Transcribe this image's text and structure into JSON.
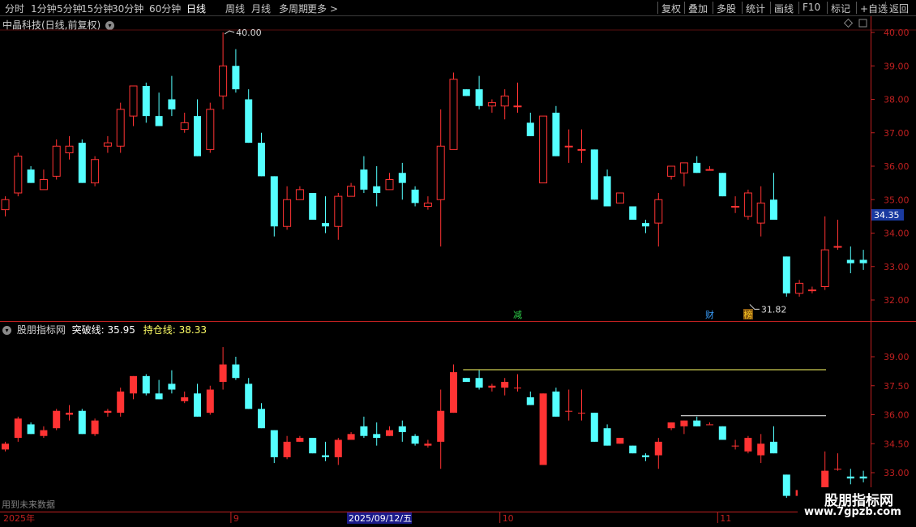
{
  "toolbar": {
    "periods": [
      "分时",
      "1分钟",
      "5分钟",
      "15分钟",
      "30分钟",
      "60分钟",
      "日线",
      "周线",
      "月线",
      "多周期",
      "更多 >"
    ],
    "active_period": "日线",
    "right_buttons": [
      "复权",
      "叠加",
      "多股",
      "统计",
      "画线",
      "F10",
      "标记",
      "+自选",
      "返回"
    ]
  },
  "stock": {
    "title": "中晶科技(日线,前复权)",
    "high_label": "40.00",
    "low_label": "31.82",
    "current_price": "34.35"
  },
  "price_axis": {
    "ticks": [
      "40.00",
      "39.00",
      "38.00",
      "37.00",
      "36.00",
      "35.00",
      "34.00",
      "33.00",
      "32.00"
    ],
    "ylim": [
      31.6,
      40.4
    ]
  },
  "indicator": {
    "name": "股朋指标网",
    "line1_label": "突破线:",
    "line1_value": "35.95",
    "line2_label": "持仓线:",
    "line2_value": "38.33",
    "ticks": [
      "39.00",
      "37.50",
      "36.00",
      "34.50",
      "33.00"
    ]
  },
  "date_axis": {
    "labels": [
      "2025年",
      "9",
      "2025/09/12/五",
      "10",
      "11"
    ]
  },
  "markers": [
    {
      "text": "减",
      "color": "#2ed14a"
    },
    {
      "text": "财",
      "color": "#3aa0ff"
    },
    {
      "text": "榜",
      "color": "#f0c020"
    }
  ],
  "footer_note": "用到未来数据",
  "watermark": {
    "title": "股朋指标网",
    "url": "www.7gpzb.com"
  },
  "colors": {
    "up": "#ff3333",
    "down": "#54ffff",
    "yellow": "#ffff66",
    "white": "#ffffff",
    "axis": "#c02020"
  },
  "chart_data": {
    "type": "candlestick",
    "ohlc": [
      [
        34.7,
        35.1,
        34.5,
        35.0
      ],
      [
        35.2,
        36.4,
        35.1,
        36.3
      ],
      [
        35.9,
        36.0,
        35.5,
        35.5
      ],
      [
        35.3,
        35.9,
        35.3,
        35.6
      ],
      [
        35.7,
        36.8,
        35.6,
        36.6
      ],
      [
        36.4,
        36.9,
        36.2,
        36.6
      ],
      [
        36.7,
        36.8,
        35.5,
        35.5
      ],
      [
        35.5,
        36.3,
        35.4,
        36.2
      ],
      [
        36.6,
        36.9,
        36.4,
        36.7
      ],
      [
        36.6,
        37.9,
        36.4,
        37.7
      ],
      [
        37.5,
        38.4,
        37.2,
        38.4
      ],
      [
        38.4,
        38.5,
        37.3,
        37.5
      ],
      [
        37.5,
        38.2,
        37.2,
        37.2
      ],
      [
        38.0,
        38.7,
        37.5,
        37.7
      ],
      [
        37.1,
        37.6,
        37.0,
        37.3
      ],
      [
        37.5,
        38.0,
        36.3,
        36.3
      ],
      [
        36.5,
        37.9,
        36.4,
        37.7
      ],
      [
        38.1,
        40.0,
        37.7,
        39.0
      ],
      [
        39.0,
        39.5,
        38.2,
        38.3
      ],
      [
        38.0,
        38.3,
        36.7,
        36.7
      ],
      [
        36.7,
        37.0,
        35.7,
        35.7
      ],
      [
        35.7,
        35.7,
        33.9,
        34.2
      ],
      [
        34.2,
        35.4,
        34.1,
        35.0
      ],
      [
        35.0,
        35.4,
        35.0,
        35.3
      ],
      [
        35.2,
        35.2,
        34.4,
        34.4
      ],
      [
        34.3,
        35.1,
        34.0,
        34.2
      ],
      [
        34.2,
        35.2,
        33.8,
        35.1
      ],
      [
        35.1,
        35.5,
        35.1,
        35.4
      ],
      [
        35.9,
        36.3,
        35.2,
        35.3
      ],
      [
        35.4,
        36.0,
        34.8,
        35.2
      ],
      [
        35.3,
        35.8,
        35.3,
        35.6
      ],
      [
        35.8,
        36.1,
        35.0,
        35.5
      ],
      [
        35.3,
        35.4,
        34.8,
        34.9
      ],
      [
        34.8,
        35.1,
        34.7,
        34.9
      ],
      [
        35.0,
        37.7,
        33.6,
        36.6
      ],
      [
        36.5,
        38.8,
        36.5,
        38.6
      ],
      [
        38.3,
        38.3,
        38.1,
        38.1
      ],
      [
        38.3,
        38.7,
        37.7,
        37.8
      ],
      [
        37.8,
        38.0,
        37.6,
        37.9
      ],
      [
        37.8,
        38.3,
        37.4,
        38.1
      ],
      [
        37.8,
        38.5,
        37.6,
        37.8
      ],
      [
        37.3,
        37.6,
        36.9,
        36.9
      ],
      [
        35.5,
        37.5,
        35.5,
        37.5
      ],
      [
        37.6,
        37.8,
        36.3,
        36.3
      ],
      [
        36.6,
        37.1,
        36.1,
        36.6
      ],
      [
        36.5,
        37.1,
        36.1,
        36.5
      ],
      [
        36.5,
        36.5,
        35.0,
        35.0
      ],
      [
        35.7,
        35.9,
        34.8,
        34.8
      ],
      [
        34.9,
        35.2,
        34.9,
        35.2
      ],
      [
        34.8,
        34.8,
        34.4,
        34.4
      ],
      [
        34.3,
        34.4,
        34.0,
        34.2
      ],
      [
        34.3,
        35.2,
        33.6,
        35.0
      ],
      [
        35.7,
        36.0,
        35.6,
        36.0
      ],
      [
        35.8,
        36.1,
        35.4,
        36.1
      ],
      [
        36.1,
        36.3,
        35.8,
        35.8
      ],
      [
        35.9,
        36.0,
        35.9,
        35.9
      ],
      [
        35.8,
        35.8,
        35.1,
        35.1
      ],
      [
        34.8,
        35.1,
        34.6,
        34.8
      ],
      [
        34.5,
        35.3,
        34.4,
        35.2
      ],
      [
        34.3,
        35.4,
        33.9,
        34.9
      ],
      [
        35.0,
        35.8,
        34.4,
        34.4
      ],
      [
        33.3,
        33.3,
        32.1,
        32.2
      ],
      [
        32.2,
        32.6,
        32.1,
        32.5
      ],
      [
        32.3,
        32.4,
        32.2,
        32.3
      ],
      [
        32.4,
        34.5,
        32.3,
        33.5
      ],
      [
        33.6,
        34.4,
        33.5,
        33.6
      ],
      [
        33.2,
        33.6,
        32.8,
        33.1
      ],
      [
        33.2,
        33.5,
        32.9,
        33.1
      ]
    ],
    "indicator_ohlc": [
      [
        34.2,
        34.6,
        34.1,
        34.5
      ],
      [
        34.8,
        35.9,
        34.6,
        35.8
      ],
      [
        35.5,
        35.6,
        35.0,
        35.0
      ],
      [
        34.9,
        35.4,
        34.8,
        35.2
      ],
      [
        35.3,
        36.3,
        35.2,
        36.2
      ],
      [
        36.0,
        36.5,
        35.7,
        36.1
      ],
      [
        36.2,
        36.3,
        35.0,
        35.0
      ],
      [
        35.0,
        35.8,
        34.9,
        35.7
      ],
      [
        36.1,
        36.3,
        35.9,
        36.2
      ],
      [
        36.1,
        37.4,
        35.9,
        37.2
      ],
      [
        37.1,
        38.0,
        36.8,
        38.0
      ],
      [
        38.0,
        38.1,
        37.0,
        37.1
      ],
      [
        37.1,
        37.8,
        36.8,
        36.8
      ],
      [
        37.6,
        38.3,
        37.1,
        37.3
      ],
      [
        36.7,
        37.2,
        36.6,
        36.9
      ],
      [
        37.1,
        37.6,
        35.9,
        35.9
      ],
      [
        36.1,
        37.5,
        36.0,
        37.3
      ],
      [
        37.7,
        39.5,
        37.3,
        38.6
      ],
      [
        38.6,
        39.0,
        37.8,
        37.9
      ],
      [
        37.6,
        37.9,
        36.3,
        36.3
      ],
      [
        36.3,
        36.6,
        35.3,
        35.3
      ],
      [
        35.2,
        35.2,
        33.5,
        33.8
      ],
      [
        33.8,
        34.9,
        33.7,
        34.6
      ],
      [
        34.6,
        34.9,
        34.6,
        34.8
      ],
      [
        34.8,
        34.8,
        34.0,
        34.0
      ],
      [
        33.9,
        34.6,
        33.6,
        33.8
      ],
      [
        33.8,
        34.8,
        33.4,
        34.7
      ],
      [
        34.7,
        35.1,
        34.7,
        35.0
      ],
      [
        35.4,
        35.9,
        34.8,
        34.9
      ],
      [
        35.0,
        35.6,
        34.4,
        34.8
      ],
      [
        34.9,
        35.4,
        34.9,
        35.2
      ],
      [
        35.4,
        35.7,
        34.6,
        35.1
      ],
      [
        34.9,
        35.0,
        34.4,
        34.5
      ],
      [
        34.4,
        34.7,
        34.3,
        34.5
      ],
      [
        34.6,
        37.3,
        33.2,
        36.2
      ],
      [
        36.1,
        38.6,
        36.1,
        38.2
      ],
      [
        37.9,
        37.9,
        37.7,
        37.7
      ],
      [
        37.9,
        38.3,
        37.3,
        37.4
      ],
      [
        37.4,
        37.6,
        37.2,
        37.5
      ],
      [
        37.4,
        37.9,
        37.0,
        37.7
      ],
      [
        37.4,
        38.1,
        37.2,
        37.4
      ],
      [
        36.9,
        37.2,
        36.5,
        36.5
      ],
      [
        33.4,
        37.1,
        33.4,
        37.1
      ],
      [
        37.2,
        37.4,
        35.9,
        35.9
      ],
      [
        36.2,
        37.3,
        35.7,
        36.2
      ],
      [
        36.1,
        37.3,
        35.7,
        36.1
      ],
      [
        36.1,
        36.1,
        34.6,
        34.6
      ],
      [
        35.3,
        35.5,
        34.4,
        34.4
      ],
      [
        34.5,
        34.8,
        34.5,
        34.8
      ],
      [
        34.4,
        34.4,
        34.0,
        34.0
      ],
      [
        33.9,
        34.0,
        33.6,
        33.8
      ],
      [
        33.9,
        34.8,
        33.2,
        34.6
      ],
      [
        35.3,
        35.6,
        35.2,
        35.6
      ],
      [
        35.4,
        35.7,
        35.0,
        35.7
      ],
      [
        35.7,
        35.9,
        35.4,
        35.4
      ],
      [
        35.5,
        35.6,
        35.5,
        35.5
      ],
      [
        35.4,
        35.4,
        34.7,
        34.7
      ],
      [
        34.4,
        34.7,
        34.2,
        34.4
      ],
      [
        34.1,
        34.9,
        34.0,
        34.8
      ],
      [
        33.9,
        35.0,
        33.5,
        34.5
      ],
      [
        34.6,
        35.4,
        34.0,
        34.0
      ],
      [
        32.9,
        32.9,
        31.7,
        31.8
      ],
      [
        31.8,
        32.2,
        31.7,
        32.1
      ],
      [
        31.9,
        32.0,
        31.8,
        31.9
      ],
      [
        32.0,
        34.1,
        31.9,
        33.1
      ],
      [
        33.2,
        34.0,
        33.1,
        33.2
      ],
      [
        32.8,
        33.2,
        32.4,
        32.7
      ],
      [
        32.8,
        33.1,
        32.5,
        32.7
      ]
    ],
    "indicator_ylim": [
      31.0,
      40.2
    ],
    "hold_line": {
      "value": 38.33,
      "start_index": 36,
      "end_index": 66
    },
    "break_line": {
      "value": 35.95,
      "start_index": 53,
      "end_index": 66
    }
  }
}
